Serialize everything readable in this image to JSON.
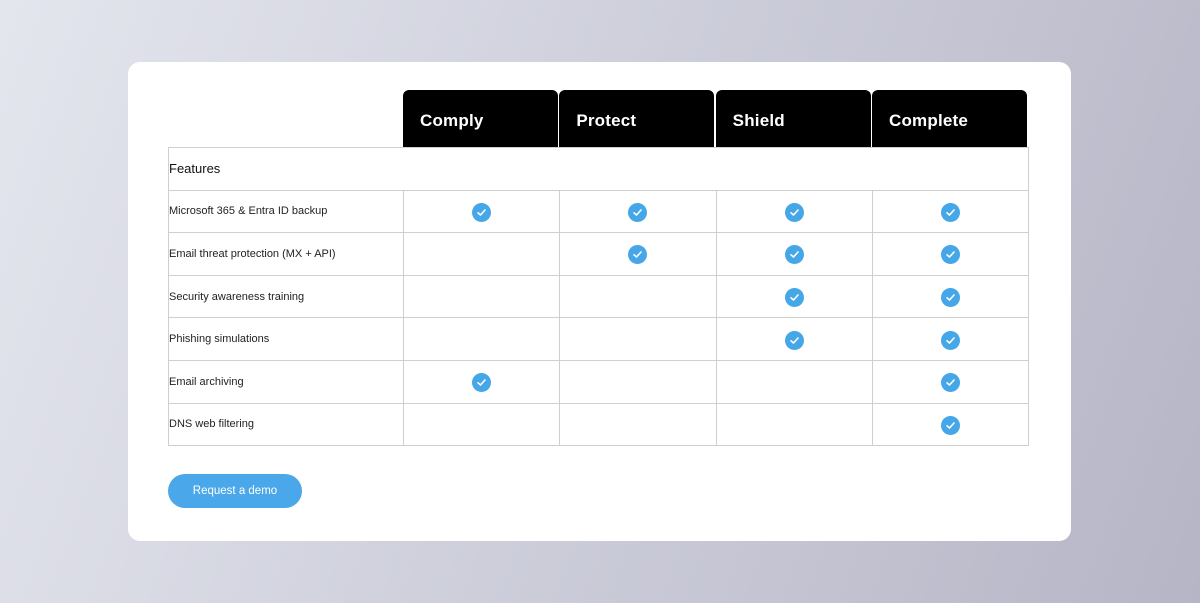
{
  "plans": [
    "Comply",
    "Protect",
    "Shield",
    "Complete"
  ],
  "section_label": "Features",
  "features": [
    {
      "name": "Microsoft 365 & Entra ID backup",
      "included": [
        true,
        true,
        true,
        true
      ]
    },
    {
      "name": "Email threat protection (MX + API)",
      "included": [
        false,
        true,
        true,
        true
      ]
    },
    {
      "name": "Security awareness training",
      "included": [
        false,
        false,
        true,
        true
      ]
    },
    {
      "name": "Phishing simulations",
      "included": [
        false,
        false,
        true,
        true
      ]
    },
    {
      "name": "Email archiving",
      "included": [
        true,
        false,
        false,
        true
      ]
    },
    {
      "name": "DNS web filtering",
      "included": [
        false,
        false,
        false,
        true
      ]
    }
  ],
  "check_icon": "check-circle-icon",
  "cta_label": "Request a demo",
  "colors": {
    "header_bg": "#000000",
    "check": "#45a6e8",
    "button": "#4aa8ea",
    "card": "#ffffff"
  }
}
